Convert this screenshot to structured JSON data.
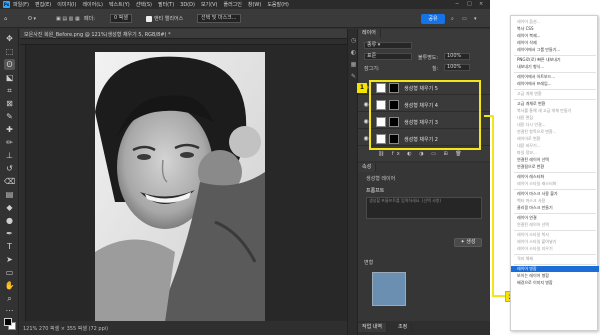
{
  "menubar": {
    "items": [
      "파일(F)",
      "편집(E)",
      "이미지(I)",
      "레이어(L)",
      "텍스트(Y)",
      "선택(S)",
      "필터(T)",
      "3D(D)",
      "보기(V)",
      "플러그인",
      "창(W)",
      "도움말(H)"
    ],
    "window_controls": [
      "−",
      "□",
      "×"
    ]
  },
  "options": {
    "feather_label": "페더:",
    "feather_value": "0 픽셀",
    "antialias_label": "앤티 앨리어스",
    "select_mask_label": "선택 및 마스크...",
    "share_label": "공유"
  },
  "document": {
    "tab_title": "보은사진 복원_Before.png @ 121%(생성형 채우기 5, RGB/8#) *",
    "status": "121%    270 픽셀 × 355 픽셀 (72 ppi)"
  },
  "layers_panel": {
    "tab_title": "레이어",
    "kind_label": "종류",
    "blend_mode": "표준",
    "opacity_label": "불투명도:",
    "opacity_value": "100%",
    "lock_label": "잠그기:",
    "fill_label": "칠:",
    "fill_value": "100%",
    "layers": [
      "생성형 채우기 5",
      "생성형 채우기 4",
      "생성형 채우기 3",
      "생성형 채우기 2"
    ]
  },
  "properties_panel": {
    "tab_title": "속성",
    "layer_label": "생성형 레이어",
    "prompt_title": "프롬프트",
    "prompt_placeholder": "생성할 프롬프트를 입력하세요. (선택 사항)",
    "generate_label": "생성",
    "variations_label": "변형"
  },
  "bottom_tabs": [
    "작업 내역",
    "조정"
  ],
  "callouts": {
    "one": "1",
    "two": "2"
  },
  "context_menu": {
    "items": [
      {
        "label": "레이어 옵션...",
        "state": "dim"
      },
      {
        "label": "복사 CSS",
        "state": "normal"
      },
      {
        "label": "레이어 복제...",
        "state": "normal"
      },
      {
        "label": "레이어 삭제",
        "state": "normal"
      },
      {
        "label": "레이어에서 그룹 만들기...",
        "state": "normal"
      },
      {
        "label": "",
        "state": "sep"
      },
      {
        "label": "PNG로(로) 빠른 내보내기",
        "state": "normal"
      },
      {
        "label": "내보내기 형식...",
        "state": "normal"
      },
      {
        "label": "",
        "state": "sep"
      },
      {
        "label": "레이어에서 아트보드...",
        "state": "normal"
      },
      {
        "label": "레이어에서 프레임...",
        "state": "normal"
      },
      {
        "label": "",
        "state": "sep"
      },
      {
        "label": "고급 개체 변환",
        "state": "dim"
      },
      {
        "label": "",
        "state": "sep"
      },
      {
        "label": "고급 개체로 변환",
        "state": "normal"
      },
      {
        "label": "복사를 통해 새 고급 개체 만들기",
        "state": "dim"
      },
      {
        "label": "내용 편집",
        "state": "dim"
      },
      {
        "label": "내용 다시 연결...",
        "state": "dim"
      },
      {
        "label": "연결된 항목으로 변환...",
        "state": "dim"
      },
      {
        "label": "레이어로 변환",
        "state": "dim"
      },
      {
        "label": "내용 바꾸기...",
        "state": "dim"
      },
      {
        "label": "파일 정보...",
        "state": "dim"
      },
      {
        "label": "연결된 레이어 선택",
        "state": "normal"
      },
      {
        "label": "연결됨으로 변환",
        "state": "normal"
      },
      {
        "label": "",
        "state": "sep"
      },
      {
        "label": "레이어 래스터화",
        "state": "normal"
      },
      {
        "label": "레이어 스타일 래스터화",
        "state": "dim"
      },
      {
        "label": "",
        "state": "sep"
      },
      {
        "label": "레이어 마스크 사용 불가",
        "state": "normal"
      },
      {
        "label": "벡터 마스크 사용",
        "state": "dim"
      },
      {
        "label": "클리핑 마스크 만들기",
        "state": "normal"
      },
      {
        "label": "",
        "state": "sep"
      },
      {
        "label": "레이어 연결",
        "state": "normal"
      },
      {
        "label": "연결된 레이어 선택",
        "state": "dim"
      },
      {
        "label": "",
        "state": "sep"
      },
      {
        "label": "레이어 스타일 복사",
        "state": "dim"
      },
      {
        "label": "레이어 스타일 붙여넣기",
        "state": "dim"
      },
      {
        "label": "레이어 스타일 지우기",
        "state": "dim"
      },
      {
        "label": "",
        "state": "sep"
      },
      {
        "label": "격리 해제",
        "state": "dim"
      },
      {
        "label": "",
        "state": "sep"
      },
      {
        "label": "레이어 병합",
        "state": "hl"
      },
      {
        "label": "보이는 레이어 병합",
        "state": "normal"
      },
      {
        "label": "배경으로 이미지 병합",
        "state": "normal"
      }
    ]
  },
  "colors": {
    "accent": "#1473e6",
    "highlight": "#f2e51a",
    "menu_highlight": "#1c6ed6"
  }
}
